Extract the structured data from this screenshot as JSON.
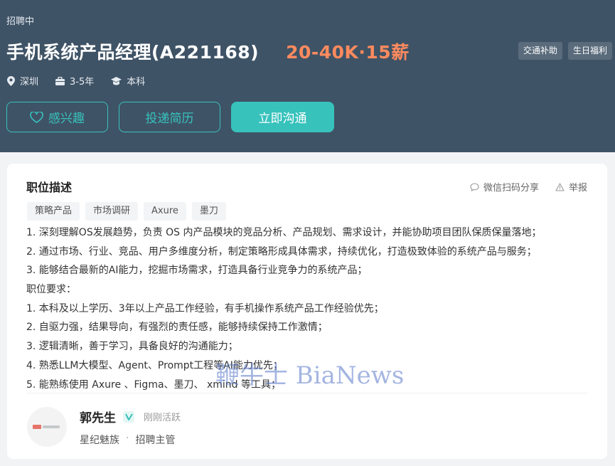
{
  "header": {
    "status": "招聘中",
    "job_title": "手机系统产品经理(A221168)",
    "salary": "20-40K·15薪",
    "perks": [
      "交通补助",
      "生日福利"
    ],
    "meta": {
      "location": "深圳",
      "experience": "3-5年",
      "education": "本科"
    },
    "buttons": {
      "interest": "感兴趣",
      "apply": "投递简历",
      "chat": "立即沟通"
    },
    "colors": {
      "background": "#3f5366",
      "accent": "#37c2bc",
      "salary": "#fe8a5e"
    }
  },
  "card": {
    "heading": "职位描述",
    "actions": {
      "share": "微信扫码分享",
      "report": "举报"
    },
    "tags": [
      "策略产品",
      "市场调研",
      "Axure",
      "墨刀"
    ],
    "description": [
      "1.  深刻理解OS发展趋势，负责 OS 内产品模块的竞品分析、产品规划、需求设计，并能协助项目团队保质保量落地；",
      "2.  通过市场、行业、竞品、用户多维度分析，制定策略形成具体需求，持续优化，打造极致体验的系统产品与服务；",
      "3.  能够结合最新的AI能力，挖掘市场需求，打造具备行业竞争力的系统产品；",
      "职位要求：",
      "1.  本科及以上学历、3年以上产品工作经验，有手机操作系统产品工作经验优先；",
      "2.  自驱力强，结果导向，有强烈的责任感，能够持续保持工作激情；",
      "3.  逻辑清晰，善于学习，具备良好的沟通能力；",
      "4.  熟悉LLM大模型、Agent、Prompt工程等AI能力优先；",
      "5.  能熟练使用 Axure 、Figma、墨刀、 xmind 等工具；"
    ]
  },
  "recruiter": {
    "name": "郭先生",
    "active_status": "刚刚活跃",
    "company": "星纪魅族",
    "separator": "·",
    "role": "招聘主管",
    "icons": [
      "company-logo-icon",
      "verified-badge-icon"
    ]
  },
  "watermark": "鞭牛士 BiaNews"
}
